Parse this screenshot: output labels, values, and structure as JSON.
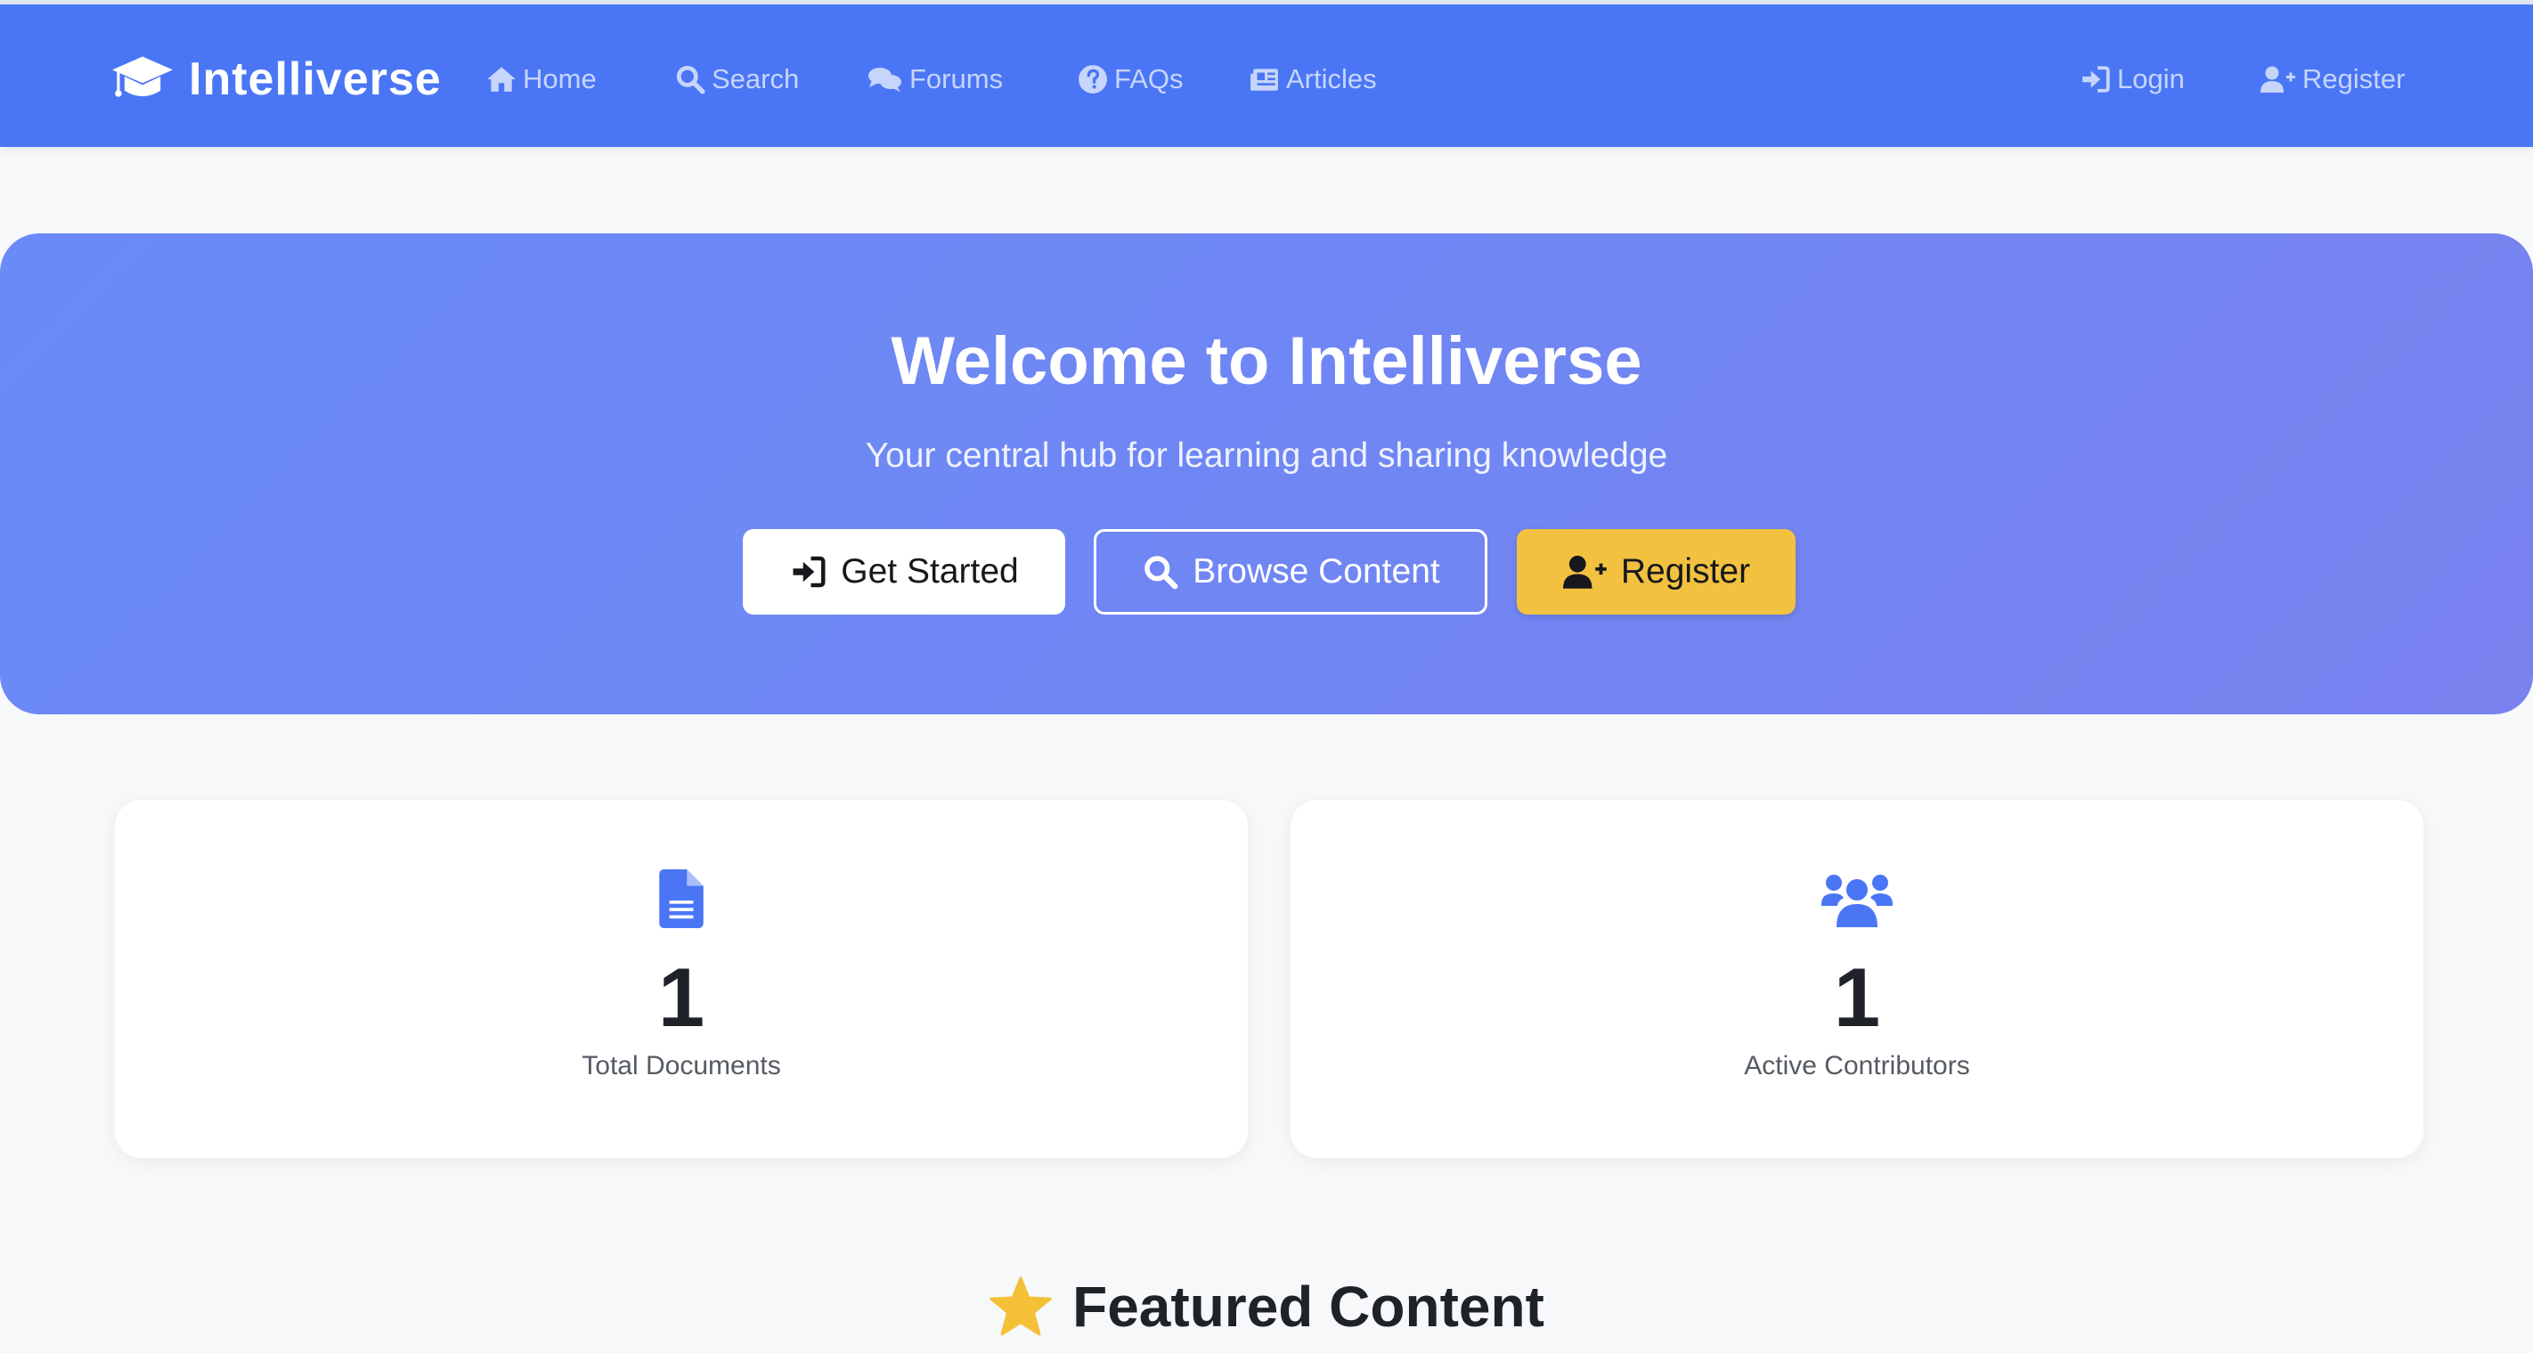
{
  "navbar": {
    "brand": "Intelliverse",
    "links": [
      {
        "label": "Home",
        "icon": "home-icon"
      },
      {
        "label": "Search",
        "icon": "search-icon"
      },
      {
        "label": "Forums",
        "icon": "comments-icon"
      },
      {
        "label": "FAQs",
        "icon": "question-circle-icon"
      },
      {
        "label": "Articles",
        "icon": "newspaper-icon"
      }
    ],
    "auth": [
      {
        "label": "Login",
        "icon": "sign-in-icon"
      },
      {
        "label": "Register",
        "icon": "user-plus-icon"
      }
    ]
  },
  "hero": {
    "title": "Welcome to Intelliverse",
    "subtitle": "Your central hub for learning and sharing knowledge",
    "buttons": [
      {
        "label": "Get Started",
        "icon": "sign-in-icon"
      },
      {
        "label": "Browse Content",
        "icon": "search-icon"
      },
      {
        "label": "Register",
        "icon": "user-plus-icon"
      }
    ]
  },
  "stats": [
    {
      "value": "1",
      "label": "Total Documents",
      "icon": "document-icon"
    },
    {
      "value": "1",
      "label": "Active Contributors",
      "icon": "users-icon"
    }
  ],
  "featured": {
    "title": "Featured Content",
    "icon": "star-icon"
  },
  "colors": {
    "navbar": "#4a76f5",
    "nav_text": "#c6d5fb",
    "hero_gradient_start": "#6a8bf7",
    "hero_gradient_end": "#7a82ef",
    "accent_yellow": "#f2c13f",
    "icon_blue": "#4a76f5",
    "star": "#f4c037"
  }
}
